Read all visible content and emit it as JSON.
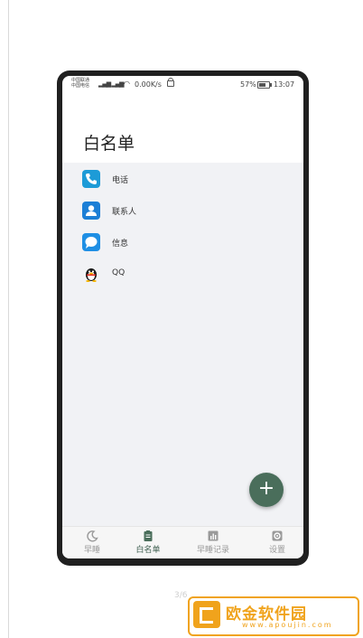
{
  "statusbar": {
    "carrier1": "中国联通",
    "carrier2": "中国电信",
    "network": "4G",
    "speed": "0.00K/s",
    "battery": "57%",
    "time": "13:07"
  },
  "page": {
    "title": "白名单"
  },
  "whitelist": [
    {
      "label": "电话",
      "icon": "phone-icon"
    },
    {
      "label": "联系人",
      "icon": "contacts-icon"
    },
    {
      "label": "信息",
      "icon": "message-icon"
    },
    {
      "label": "QQ",
      "icon": "qq-penguin-icon"
    }
  ],
  "fab": {
    "label": "+"
  },
  "nav": [
    {
      "label": "早睡",
      "icon": "moon-icon"
    },
    {
      "label": "白名单",
      "icon": "clipboard-icon"
    },
    {
      "label": "早睡记录",
      "icon": "chart-icon"
    },
    {
      "label": "设置",
      "icon": "gear-icon"
    }
  ],
  "pager": {
    "indicator": "3/6"
  },
  "watermark": {
    "title": "欧金软件园",
    "subtitle": "www.apoujin.com"
  },
  "colors": {
    "accent": "#4a6e5b",
    "list_bg": "#f1f2f5",
    "watermark": "#f0a31c"
  }
}
